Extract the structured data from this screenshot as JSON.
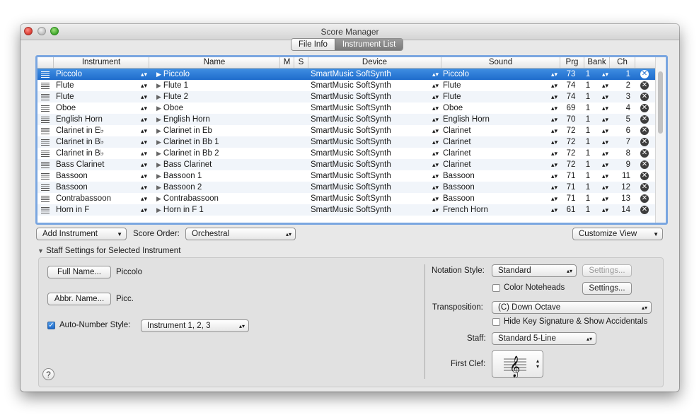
{
  "window": {
    "title": "Score Manager"
  },
  "tabs": [
    {
      "label": "File Info",
      "active": false
    },
    {
      "label": "Instrument List",
      "active": true
    }
  ],
  "table": {
    "columns": [
      "Instrument",
      "Name",
      "M",
      "S",
      "Device",
      "Sound",
      "Prg",
      "Bank",
      "Ch"
    ],
    "rows": [
      {
        "instrument": "Piccolo",
        "name": "Piccolo",
        "device": "SmartMusic SoftSynth",
        "sound": "Piccolo",
        "prg": "73",
        "bank": "1",
        "ch": "1",
        "selected": true
      },
      {
        "instrument": "Flute",
        "name": "Flute 1",
        "device": "SmartMusic SoftSynth",
        "sound": "Flute",
        "prg": "74",
        "bank": "1",
        "ch": "2"
      },
      {
        "instrument": "Flute",
        "name": "Flute 2",
        "device": "SmartMusic SoftSynth",
        "sound": "Flute",
        "prg": "74",
        "bank": "1",
        "ch": "3"
      },
      {
        "instrument": "Oboe",
        "name": "Oboe",
        "device": "SmartMusic SoftSynth",
        "sound": "Oboe",
        "prg": "69",
        "bank": "1",
        "ch": "4"
      },
      {
        "instrument": "English Horn",
        "name": "English Horn",
        "device": "SmartMusic SoftSynth",
        "sound": "English Horn",
        "prg": "70",
        "bank": "1",
        "ch": "5"
      },
      {
        "instrument": "Clarinet in E♭",
        "name": "Clarinet in Eb",
        "device": "SmartMusic SoftSynth",
        "sound": "Clarinet",
        "prg": "72",
        "bank": "1",
        "ch": "6"
      },
      {
        "instrument": "Clarinet in B♭",
        "name": "Clarinet in Bb 1",
        "device": "SmartMusic SoftSynth",
        "sound": "Clarinet",
        "prg": "72",
        "bank": "1",
        "ch": "7"
      },
      {
        "instrument": "Clarinet in B♭",
        "name": "Clarinet in Bb 2",
        "device": "SmartMusic SoftSynth",
        "sound": "Clarinet",
        "prg": "72",
        "bank": "1",
        "ch": "8"
      },
      {
        "instrument": "Bass Clarinet",
        "name": "Bass Clarinet",
        "device": "SmartMusic SoftSynth",
        "sound": "Clarinet",
        "prg": "72",
        "bank": "1",
        "ch": "9"
      },
      {
        "instrument": "Bassoon",
        "name": "Bassoon 1",
        "device": "SmartMusic SoftSynth",
        "sound": "Bassoon",
        "prg": "71",
        "bank": "1",
        "ch": "11"
      },
      {
        "instrument": "Bassoon",
        "name": "Bassoon 2",
        "device": "SmartMusic SoftSynth",
        "sound": "Bassoon",
        "prg": "71",
        "bank": "1",
        "ch": "12"
      },
      {
        "instrument": "Contrabassoon",
        "name": "Contrabassoon",
        "device": "SmartMusic SoftSynth",
        "sound": "Bassoon",
        "prg": "71",
        "bank": "1",
        "ch": "13"
      },
      {
        "instrument": "Horn in F",
        "name": "Horn in F 1",
        "device": "SmartMusic SoftSynth",
        "sound": "French Horn",
        "prg": "61",
        "bank": "1",
        "ch": "14"
      }
    ]
  },
  "toolbar": {
    "add_instrument": "Add Instrument",
    "score_order_label": "Score Order:",
    "score_order_value": "Orchestral",
    "customize_view": "Customize View"
  },
  "staff_settings": {
    "header": "Staff Settings for Selected Instrument",
    "full_name_button": "Full Name...",
    "full_name_value": "Piccolo",
    "abbr_name_button": "Abbr. Name...",
    "abbr_name_value": "Picc.",
    "auto_number_label": "Auto-Number Style:",
    "auto_number_checked": true,
    "auto_number_value": "Instrument 1, 2, 3",
    "notation_style_label": "Notation Style:",
    "notation_style_value": "Standard",
    "settings_label": "Settings...",
    "color_noteheads_label": "Color Noteheads",
    "transposition_label": "Transposition:",
    "transposition_value": "(C) Down Octave",
    "hide_key_label": "Hide Key Signature & Show Accidentals",
    "staff_label": "Staff:",
    "staff_value": "Standard 5-Line",
    "first_clef_label": "First Clef:"
  },
  "help": "?",
  "colors": {
    "selection": "#1f6ccc",
    "focus_ring": "#7aa6e0"
  }
}
